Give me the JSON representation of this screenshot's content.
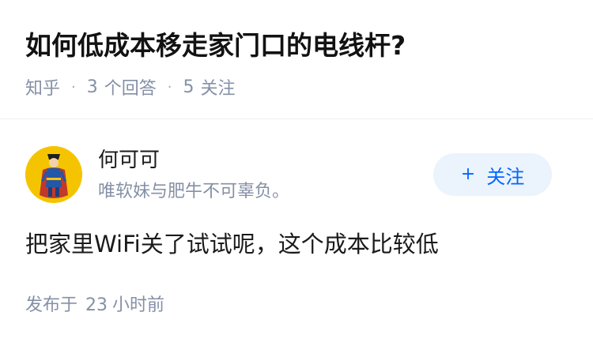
{
  "question": {
    "title": "如何低成本移走家门口的电线杆?",
    "source": "知乎",
    "answer_count": "3",
    "answer_unit": "个回答",
    "follower_count": "5",
    "follower_unit": "关注",
    "separator": "·"
  },
  "answer": {
    "author": {
      "name": "何可可",
      "bio": "唯软妹与肥牛不可辜负。",
      "avatar_icon": "cartoon-figure-avatar",
      "avatar_bg": "#f5c400"
    },
    "follow_button": {
      "plus": "+",
      "label": "关注"
    },
    "content": "把家里WiFi关了试试呢，这个成本比较低",
    "published": {
      "prefix": "发布于",
      "value": "23",
      "unit": "小时前"
    }
  },
  "colors": {
    "accent": "#0066ff",
    "accent_bg": "#ebf3fc",
    "meta_text": "#8590a6",
    "title_text": "#121212"
  }
}
